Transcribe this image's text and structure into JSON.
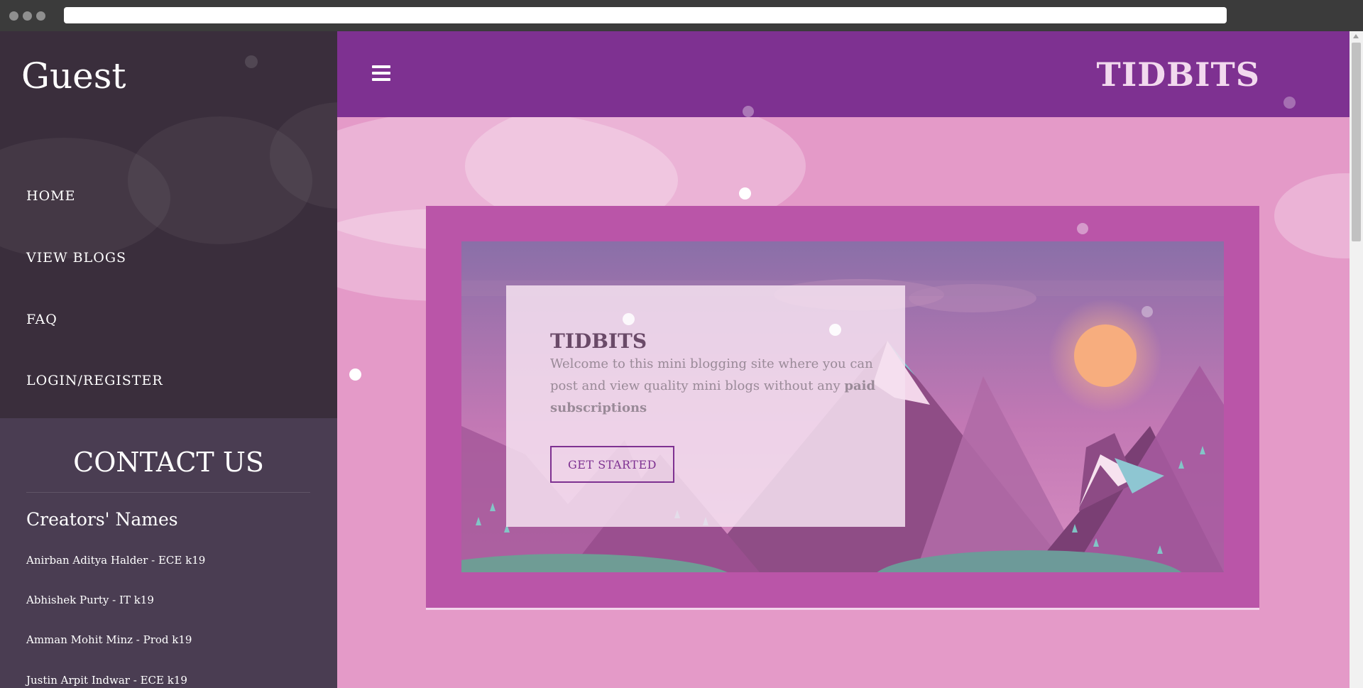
{
  "sidebar": {
    "user_name": "Guest",
    "nav": [
      {
        "label": "HOME"
      },
      {
        "label": "VIEW BLOGS"
      },
      {
        "label": "FAQ"
      },
      {
        "label": "LOGIN/REGISTER"
      }
    ],
    "contact": {
      "title": "CONTACT US",
      "subtitle": "Creators' Names",
      "creators": [
        "Anirban Aditya Halder - ECE k19",
        "Abhishek Purty - IT k19",
        "Amman Mohit Minz - Prod k19",
        "Justin Arpit Indwar - ECE k19"
      ]
    }
  },
  "header": {
    "menu_icon": "hamburger-icon",
    "brand": "TIDBITS"
  },
  "hero": {
    "title": "TIDBITS",
    "text_before": "Welcome to this mini blogging site where you can post and view quality mini blogs without any",
    "text_bold": "paid subscriptions",
    "button": "GET STARTED"
  },
  "colors": {
    "topbar": "#7e3191",
    "sidebar": "#3a2e3c",
    "contact_panel": "#4a3d52",
    "background": "#e49ac8",
    "frame": "#ba55a8",
    "accent": "#7e3191"
  }
}
